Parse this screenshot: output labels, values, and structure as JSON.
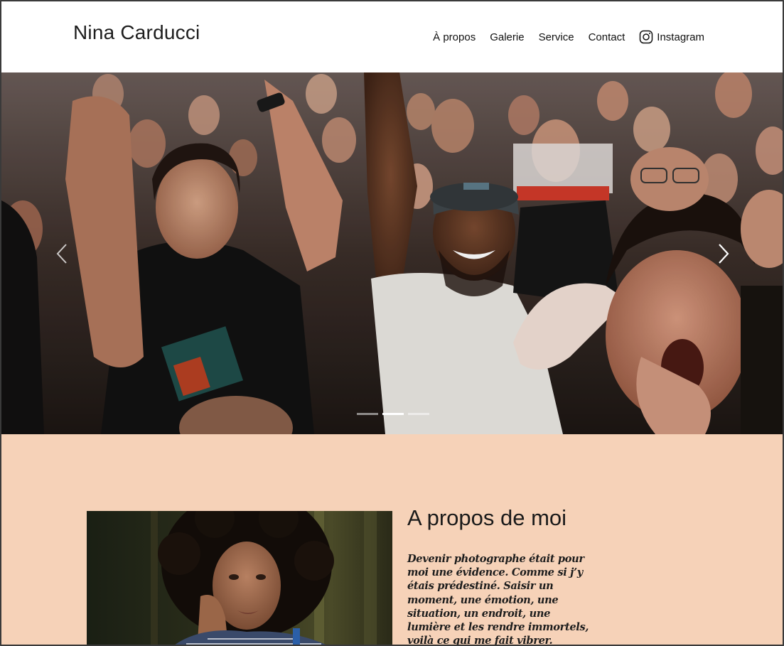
{
  "site": {
    "brand": "Nina Carducci"
  },
  "nav": {
    "items": [
      {
        "label": "À propos"
      },
      {
        "label": "Galerie"
      },
      {
        "label": "Service"
      },
      {
        "label": "Contact"
      },
      {
        "label": "Instagram",
        "icon": "instagram-icon"
      }
    ]
  },
  "carousel": {
    "prev_icon": "chevron-left-icon",
    "next_icon": "chevron-right-icon",
    "slide_count": 3,
    "active_slide": 2,
    "image": "concert-crowd-photo"
  },
  "about": {
    "title": "A propos de moi",
    "intro": "Devenir photographe était pour moi une évidence. Comme si j’y étais prédestiné. Saisir un moment, une émotion, une situation, un endroit, une lumière et les rendre immortels, voilà ce qui me fait vibrer.",
    "portrait": "portrait-photo"
  },
  "colors": {
    "about_bg": "#f6d2b8",
    "header_bg": "#ffffff",
    "text": "#1d1d1d"
  }
}
